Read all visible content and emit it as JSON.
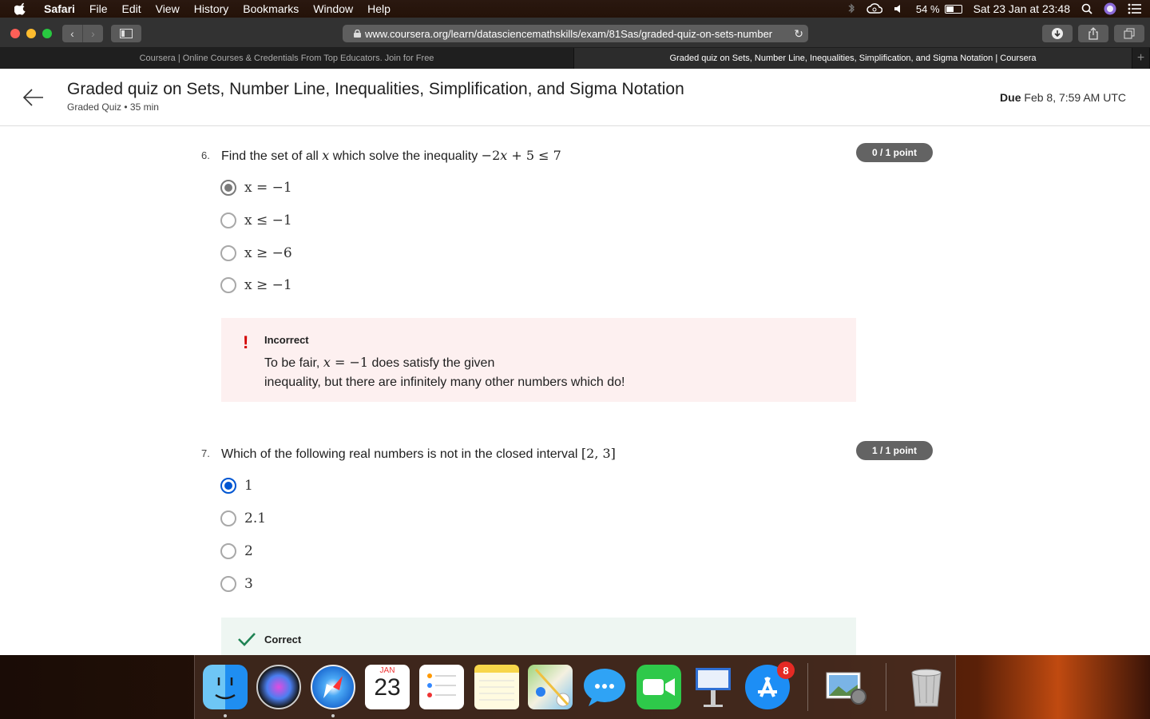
{
  "menubar": {
    "items": [
      "Safari",
      "File",
      "Edit",
      "View",
      "History",
      "Bookmarks",
      "Window",
      "Help"
    ],
    "battery": "54 %",
    "battery_level": 0.54,
    "clock": "Sat 23 Jan at  23:48"
  },
  "browser": {
    "url": "www.coursera.org/learn/datasciencemathskills/exam/81Sas/graded-quiz-on-sets-number",
    "tabs": [
      "Coursera | Online Courses & Credentials From Top Educators. Join for Free",
      "Graded quiz on Sets, Number Line, Inequalities, Simplification, and Sigma Notation | Coursera"
    ]
  },
  "header": {
    "title": "Graded quiz on Sets, Number Line, Inequalities, Simplification, and Sigma Notation",
    "meta": "Graded Quiz • 35 min",
    "due_label": "Due",
    "due_value": "Feb 8, 7:59 AM UTC"
  },
  "questions": [
    {
      "number": "6.",
      "text": "Find the set of all",
      "score": "0 / 1 point",
      "options": [
        "x = −1",
        "x ≤ −1",
        "x ≥ −6",
        "x ≥ −1"
      ],
      "selected": 0,
      "feedback": {
        "status": "Incorrect",
        "line1_pre": "To be fair,",
        "line1_post": "does satisfy the given",
        "line2": "inequality, but there are infinitely many other numbers which do!"
      }
    },
    {
      "number": "7.",
      "text": "Which of the following real numbers is not in the closed interval",
      "score": "1 / 1 point",
      "options": [
        "1",
        "2.1",
        "2",
        "3"
      ],
      "selected": 0,
      "feedback": {
        "status": "Correct"
      }
    }
  ],
  "dock": {
    "calendar_month": "JAN",
    "calendar_day": "23",
    "appstore_badge": "8"
  }
}
